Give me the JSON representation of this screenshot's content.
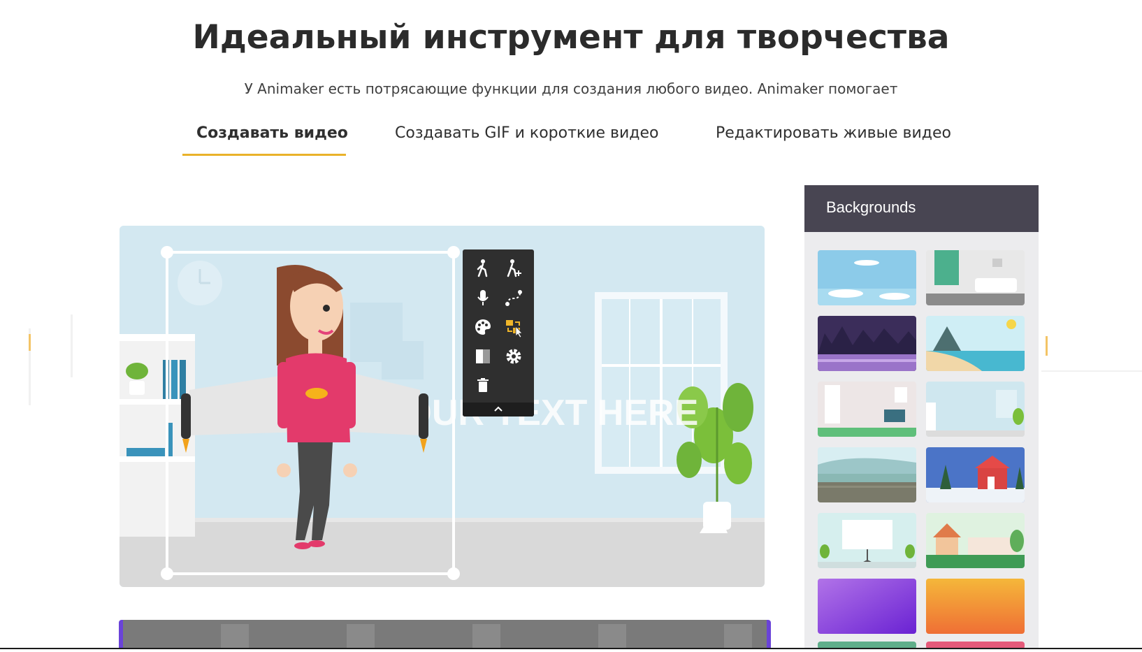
{
  "hero": {
    "title": "Идеальный инструмент для творчества",
    "subtitle": "У Animaker есть потрясающие функции для создания любого видео. Animaker помогает"
  },
  "tabs": [
    {
      "label": "Создавать видео",
      "active": true
    },
    {
      "label": "Создавать GIF и короткие видео",
      "active": false
    },
    {
      "label": "Редактировать живые видео",
      "active": false
    }
  ],
  "accent_color": "#e9b22a",
  "editor": {
    "canvas_text": "YOUR TEXT HERE",
    "toolbar_icons": [
      "walk-icon",
      "walk-add-icon",
      "mic-icon",
      "path-icon",
      "palette-icon",
      "swap-icon",
      "contrast-icon",
      "gear-icon",
      "trash-icon",
      "chevron-up-icon"
    ]
  },
  "backgrounds_panel": {
    "title": "Backgrounds",
    "thumbnails": [
      "sky",
      "living-room",
      "night-city",
      "beach",
      "room-green",
      "room-blue",
      "lake",
      "winter-house",
      "presentation-room",
      "garden",
      "gradient-purple",
      "gradient-orange"
    ]
  }
}
